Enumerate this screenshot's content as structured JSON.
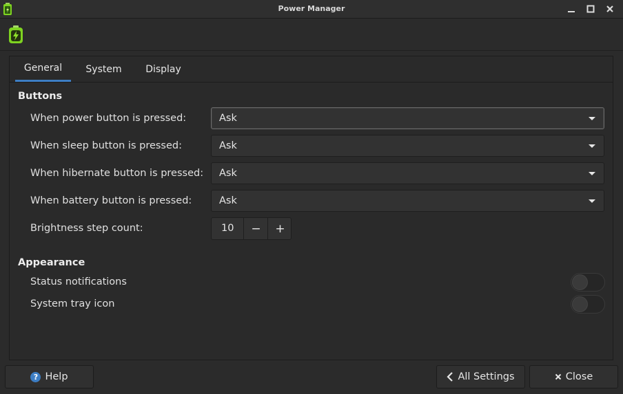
{
  "window": {
    "title": "Power Manager"
  },
  "tabs": [
    {
      "label": "General",
      "active": true
    },
    {
      "label": "System",
      "active": false
    },
    {
      "label": "Display",
      "active": false
    }
  ],
  "buttons_section": {
    "title": "Buttons",
    "rows": [
      {
        "label": "When power button is pressed:",
        "value": "Ask"
      },
      {
        "label": "When sleep button is pressed:",
        "value": "Ask"
      },
      {
        "label": "When hibernate button is pressed:",
        "value": "Ask"
      },
      {
        "label": "When battery button is pressed:",
        "value": "Ask"
      }
    ],
    "brightness": {
      "label": "Brightness step count:",
      "value": "10",
      "minus": "−",
      "plus": "+"
    }
  },
  "appearance_section": {
    "title": "Appearance",
    "status_notifications": {
      "label": "Status notifications",
      "on": false
    },
    "system_tray_icon": {
      "label": "System tray icon",
      "on": false
    }
  },
  "footer": {
    "help_label": "Help",
    "all_settings_label": "All Settings",
    "close_label": "Close"
  },
  "colors": {
    "accent": "#3d7ec4",
    "battery_green": "#7ed321"
  }
}
